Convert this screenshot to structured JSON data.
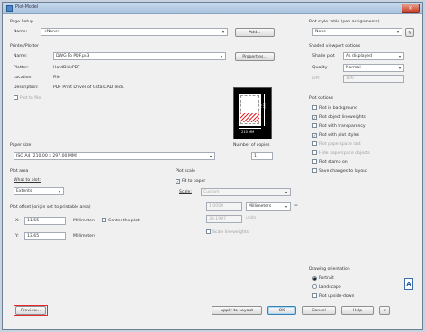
{
  "window": {
    "title": "Plot-Model",
    "close_glyph": "✕"
  },
  "page_setup": {
    "heading": "Page Setup",
    "name_label": "Name:",
    "name_value": "<None>",
    "add_button": "Add..."
  },
  "printer": {
    "heading": "Printer/Plotter",
    "name_label": "Name:",
    "name_value": "DWG To PDF.pc3",
    "properties_button": "Properties...",
    "plotter_label": "Plotter:",
    "plotter_value": "HardDiskPDF",
    "location_label": "Location:",
    "location_value": "File",
    "description_label": "Description:",
    "description_value": "PDF Print Driver of GstarCAD Tech.",
    "plot_to_file": "Plot to file",
    "preview_dim_w": "210 MM",
    "preview_dim_h": "297 MM"
  },
  "paper_size": {
    "heading": "Paper size",
    "value": "ISO A4 (210.00 x 297.00 MM)"
  },
  "copies": {
    "label": "Number of copies",
    "value": "1"
  },
  "plot_area": {
    "heading": "Plot area",
    "what_label": "What to plot:",
    "what_value": "Extents"
  },
  "plot_scale": {
    "heading": "Plot scale",
    "fit_to_paper": "Fit to paper",
    "scale_label": "Scale:",
    "scale_value": "Custom",
    "v1": "1.0000",
    "units": "Millimeters",
    "eq": "=",
    "v2": "39.1987",
    "v2_unit": "units",
    "scale_lineweights": "Scale lineweights"
  },
  "plot_offset": {
    "heading": "Plot offset (origin set to printable area)",
    "x_label": "X:",
    "x_value": "11.55",
    "x_unit": "Millimeters",
    "center": "Center the plot",
    "y_label": "Y:",
    "y_value": "13.65",
    "y_unit": "Millimeters"
  },
  "style_table": {
    "heading": "Plot style table (pen assignments)",
    "value": "None"
  },
  "viewport": {
    "heading": "Shaded viewport options",
    "shade_label": "Shade plot",
    "shade_value": "As displayed",
    "quality_label": "Quality",
    "quality_value": "Normal",
    "dpi_label": "DPI",
    "dpi_value": "100"
  },
  "options": {
    "heading": "Plot options",
    "items": [
      {
        "label": "Plot in background",
        "checked": false,
        "disabled": false
      },
      {
        "label": "Plot object lineweights",
        "checked": true,
        "disabled": false
      },
      {
        "label": "Plot with transparency",
        "checked": false,
        "disabled": false
      },
      {
        "label": "Plot with plot styles",
        "checked": true,
        "disabled": false
      },
      {
        "label": "Plot paperspace last",
        "checked": false,
        "disabled": true
      },
      {
        "label": "Hide paperspace objects",
        "checked": false,
        "disabled": true
      },
      {
        "label": "Plot stamp on",
        "checked": false,
        "disabled": false
      },
      {
        "label": "Save changes to layout",
        "checked": false,
        "disabled": false
      }
    ]
  },
  "orientation": {
    "heading": "Drawing orientation",
    "portrait": "Portrait",
    "landscape": "Landscape",
    "upside_down": "Plot upside-down",
    "icon_glyph": "A"
  },
  "footer": {
    "preview": "Preview...",
    "apply": "Apply to Layout",
    "ok": "OK",
    "cancel": "Cancel",
    "help": "Help",
    "more": "<"
  },
  "glyphs": {
    "dropdown": "▾",
    "check": "✓",
    "radio": "●"
  },
  "colors": {
    "highlight": "#e8262c",
    "accent": "#3c7fb1"
  }
}
